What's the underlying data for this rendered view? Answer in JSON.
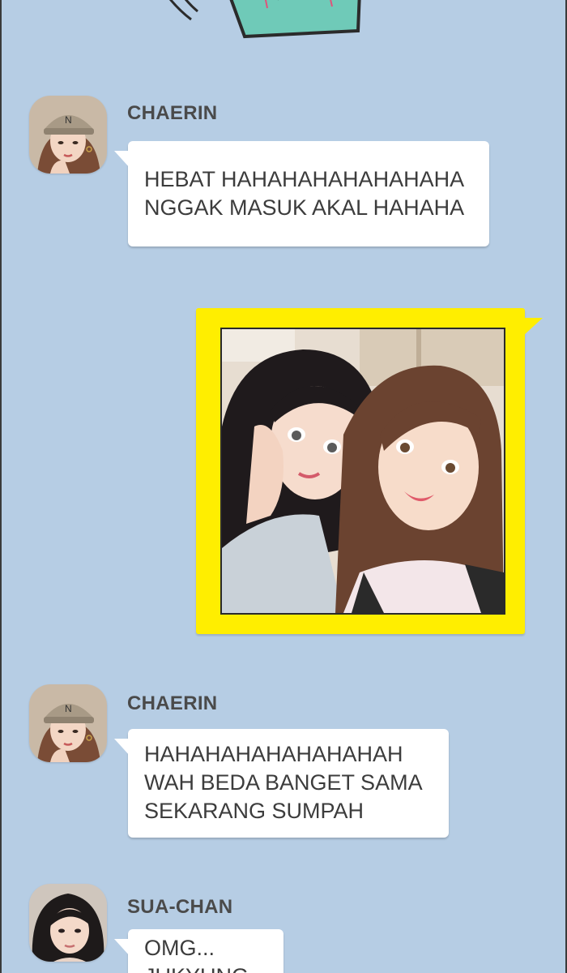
{
  "conversation": {
    "messages": [
      {
        "sender": "CHAERIN",
        "lines": [
          "HEBAT HAHAHAHAHAHAHAHA",
          "NGGAK MASUK AKAL HAHAHA"
        ]
      },
      {
        "sender": "",
        "type": "photo",
        "icon": "selfie-photo"
      },
      {
        "sender": "CHAERIN",
        "lines": [
          "HAHAHAHAHAHAHAHAH",
          "WAH BEDA BANGET SAMA",
          "SEKARANG SUMPAH"
        ]
      },
      {
        "sender": "SUA-CHAN",
        "lines": [
          "OMG...",
          "JUKYUNG..."
        ]
      }
    ]
  },
  "colors": {
    "background": "#b6cde4",
    "bubble": "#ffffff",
    "photo_bubble": "#ffee00",
    "sender_text": "#4a4a4a"
  }
}
